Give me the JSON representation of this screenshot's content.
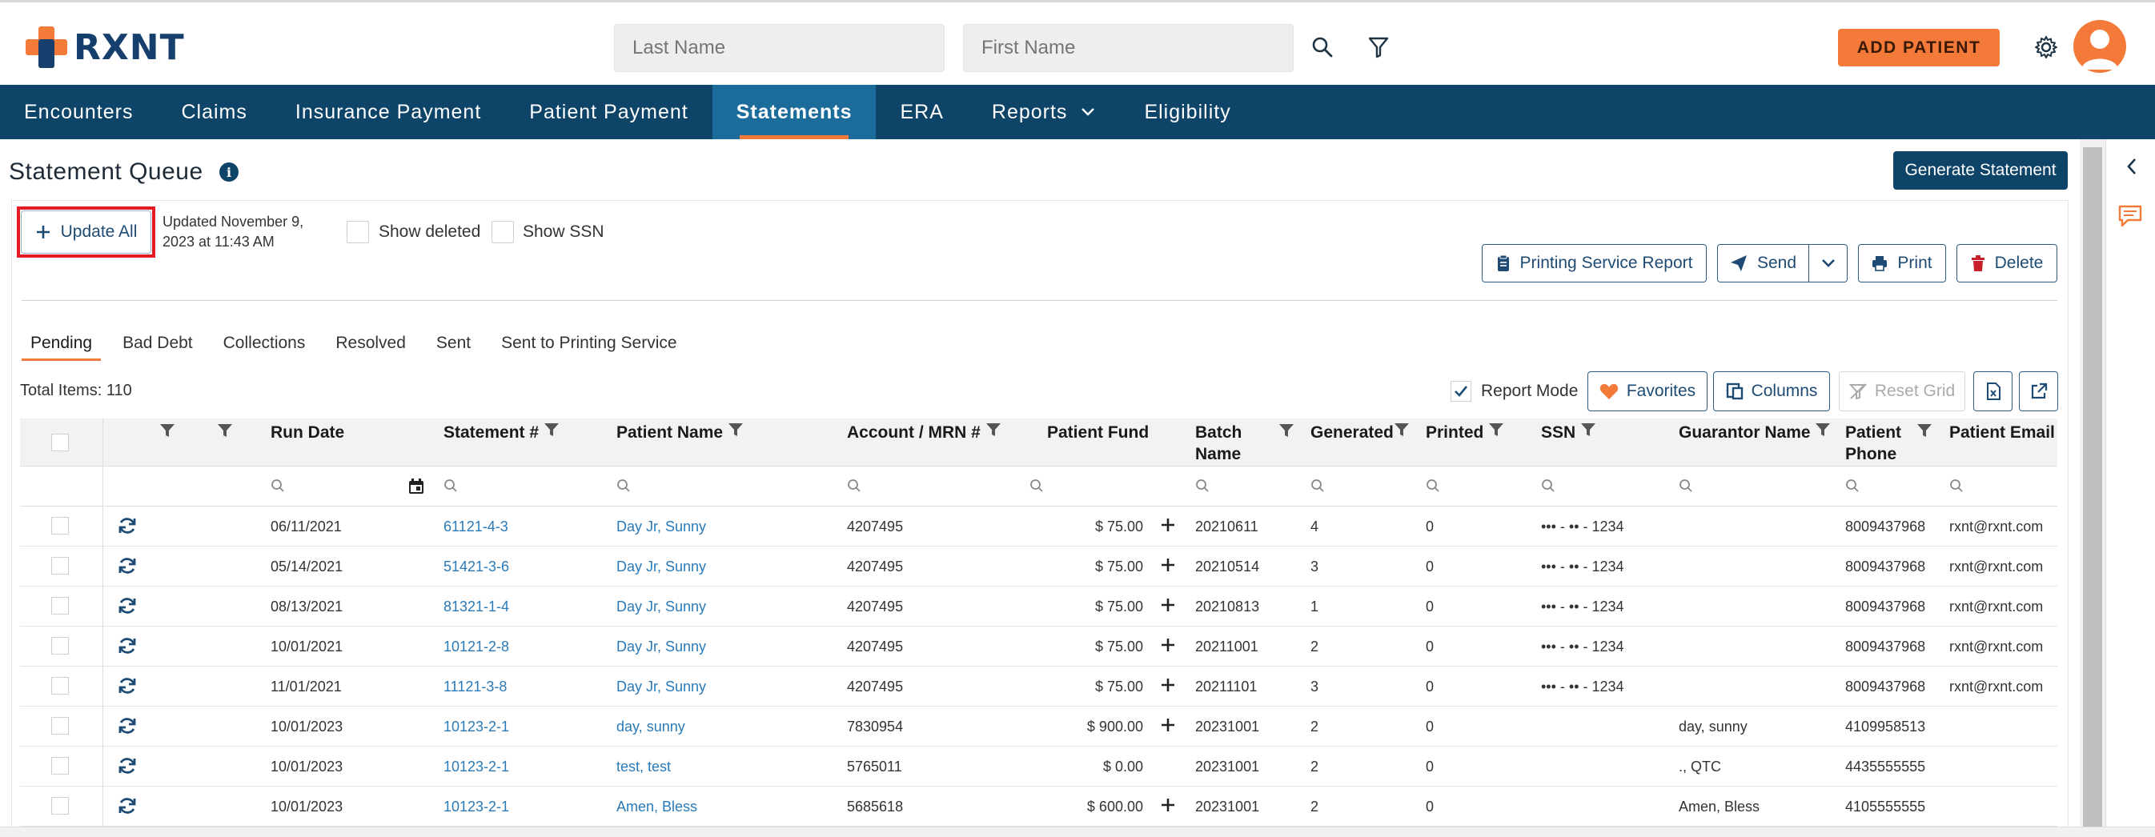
{
  "brand": {
    "name": "RXNT",
    "orange": "#f47a3a",
    "navy": "#0e4468"
  },
  "header": {
    "last_name_placeholder": "Last Name",
    "first_name_placeholder": "First Name",
    "add_patient": "ADD PATIENT"
  },
  "nav": {
    "items": [
      "Encounters",
      "Claims",
      "Insurance Payment",
      "Patient Payment",
      "Statements",
      "ERA",
      "Reports",
      "Eligibility"
    ],
    "active": "Statements"
  },
  "page": {
    "title": "Statement Queue",
    "generate_button": "Generate Statement",
    "update_all": "Update All",
    "updated_line1": "Updated November 9,",
    "updated_line2": "2023 at 11:43 AM",
    "show_deleted": "Show deleted",
    "show_ssn": "Show SSN",
    "printing_service_report": "Printing Service Report",
    "send": "Send",
    "print": "Print",
    "delete": "Delete"
  },
  "tabs": [
    "Pending",
    "Bad Debt",
    "Collections",
    "Resolved",
    "Sent",
    "Sent to Printing Service"
  ],
  "grid": {
    "total_items": "Total Items: 110",
    "report_mode": "Report Mode",
    "favorites": "Favorites",
    "columns": "Columns",
    "reset_grid": "Reset Grid",
    "headers": {
      "run_date": "Run Date",
      "statement": "Statement #",
      "patient_name": "Patient Name",
      "account": "Account / MRN #",
      "patient_fund": "Patient Fund",
      "batch1": "Batch",
      "batch2": "Name",
      "generated": "Generated",
      "printed": "Printed",
      "ssn": "SSN",
      "guarantor": "Guarantor Name",
      "phone1": "Patient",
      "phone2": "Phone",
      "email": "Patient Email"
    },
    "rows": [
      {
        "run_date": "06/11/2021",
        "statement": "61121-4-3",
        "patient": "Day Jr, Sunny",
        "account": "4207495",
        "fund": "$ 75.00",
        "batch": "20210611",
        "generated": "4",
        "printed": "0",
        "ssn": "••• - •• - 1234",
        "guarantor": "",
        "phone": "8009437968",
        "email": "rxnt@rxnt.com"
      },
      {
        "run_date": "05/14/2021",
        "statement": "51421-3-6",
        "patient": "Day Jr, Sunny",
        "account": "4207495",
        "fund": "$ 75.00",
        "batch": "20210514",
        "generated": "3",
        "printed": "0",
        "ssn": "••• - •• - 1234",
        "guarantor": "",
        "phone": "8009437968",
        "email": "rxnt@rxnt.com"
      },
      {
        "run_date": "08/13/2021",
        "statement": "81321-1-4",
        "patient": "Day Jr, Sunny",
        "account": "4207495",
        "fund": "$ 75.00",
        "batch": "20210813",
        "generated": "1",
        "printed": "0",
        "ssn": "••• - •• - 1234",
        "guarantor": "",
        "phone": "8009437968",
        "email": "rxnt@rxnt.com"
      },
      {
        "run_date": "10/01/2021",
        "statement": "10121-2-8",
        "patient": "Day Jr, Sunny",
        "account": "4207495",
        "fund": "$ 75.00",
        "batch": "20211001",
        "generated": "2",
        "printed": "0",
        "ssn": "••• - •• - 1234",
        "guarantor": "",
        "phone": "8009437968",
        "email": "rxnt@rxnt.com"
      },
      {
        "run_date": "11/01/2021",
        "statement": "11121-3-8",
        "patient": "Day Jr, Sunny",
        "account": "4207495",
        "fund": "$ 75.00",
        "batch": "20211101",
        "generated": "3",
        "printed": "0",
        "ssn": "••• - •• - 1234",
        "guarantor": "",
        "phone": "8009437968",
        "email": "rxnt@rxnt.com"
      },
      {
        "run_date": "10/01/2023",
        "statement": "10123-2-1",
        "patient": "day, sunny",
        "account": "7830954",
        "fund": "$ 900.00",
        "batch": "20231001",
        "generated": "2",
        "printed": "0",
        "ssn": "",
        "guarantor": "day, sunny",
        "phone": "4109958513",
        "email": ""
      },
      {
        "run_date": "10/01/2023",
        "statement": "10123-2-1",
        "patient": "test, test",
        "account": "5765011",
        "fund": "$ 0.00",
        "batch": "20231001",
        "generated": "2",
        "printed": "0",
        "ssn": "",
        "guarantor": "., QTC",
        "phone": "4435555555",
        "email": ""
      },
      {
        "run_date": "10/01/2023",
        "statement": "10123-2-1",
        "patient": "Amen, Bless",
        "account": "5685618",
        "fund": "$ 600.00",
        "batch": "20231001",
        "generated": "2",
        "printed": "0",
        "ssn": "",
        "guarantor": "Amen, Bless",
        "phone": "4105555555",
        "email": ""
      }
    ],
    "row_has_plus": [
      true,
      true,
      true,
      true,
      true,
      true,
      false,
      true
    ]
  }
}
